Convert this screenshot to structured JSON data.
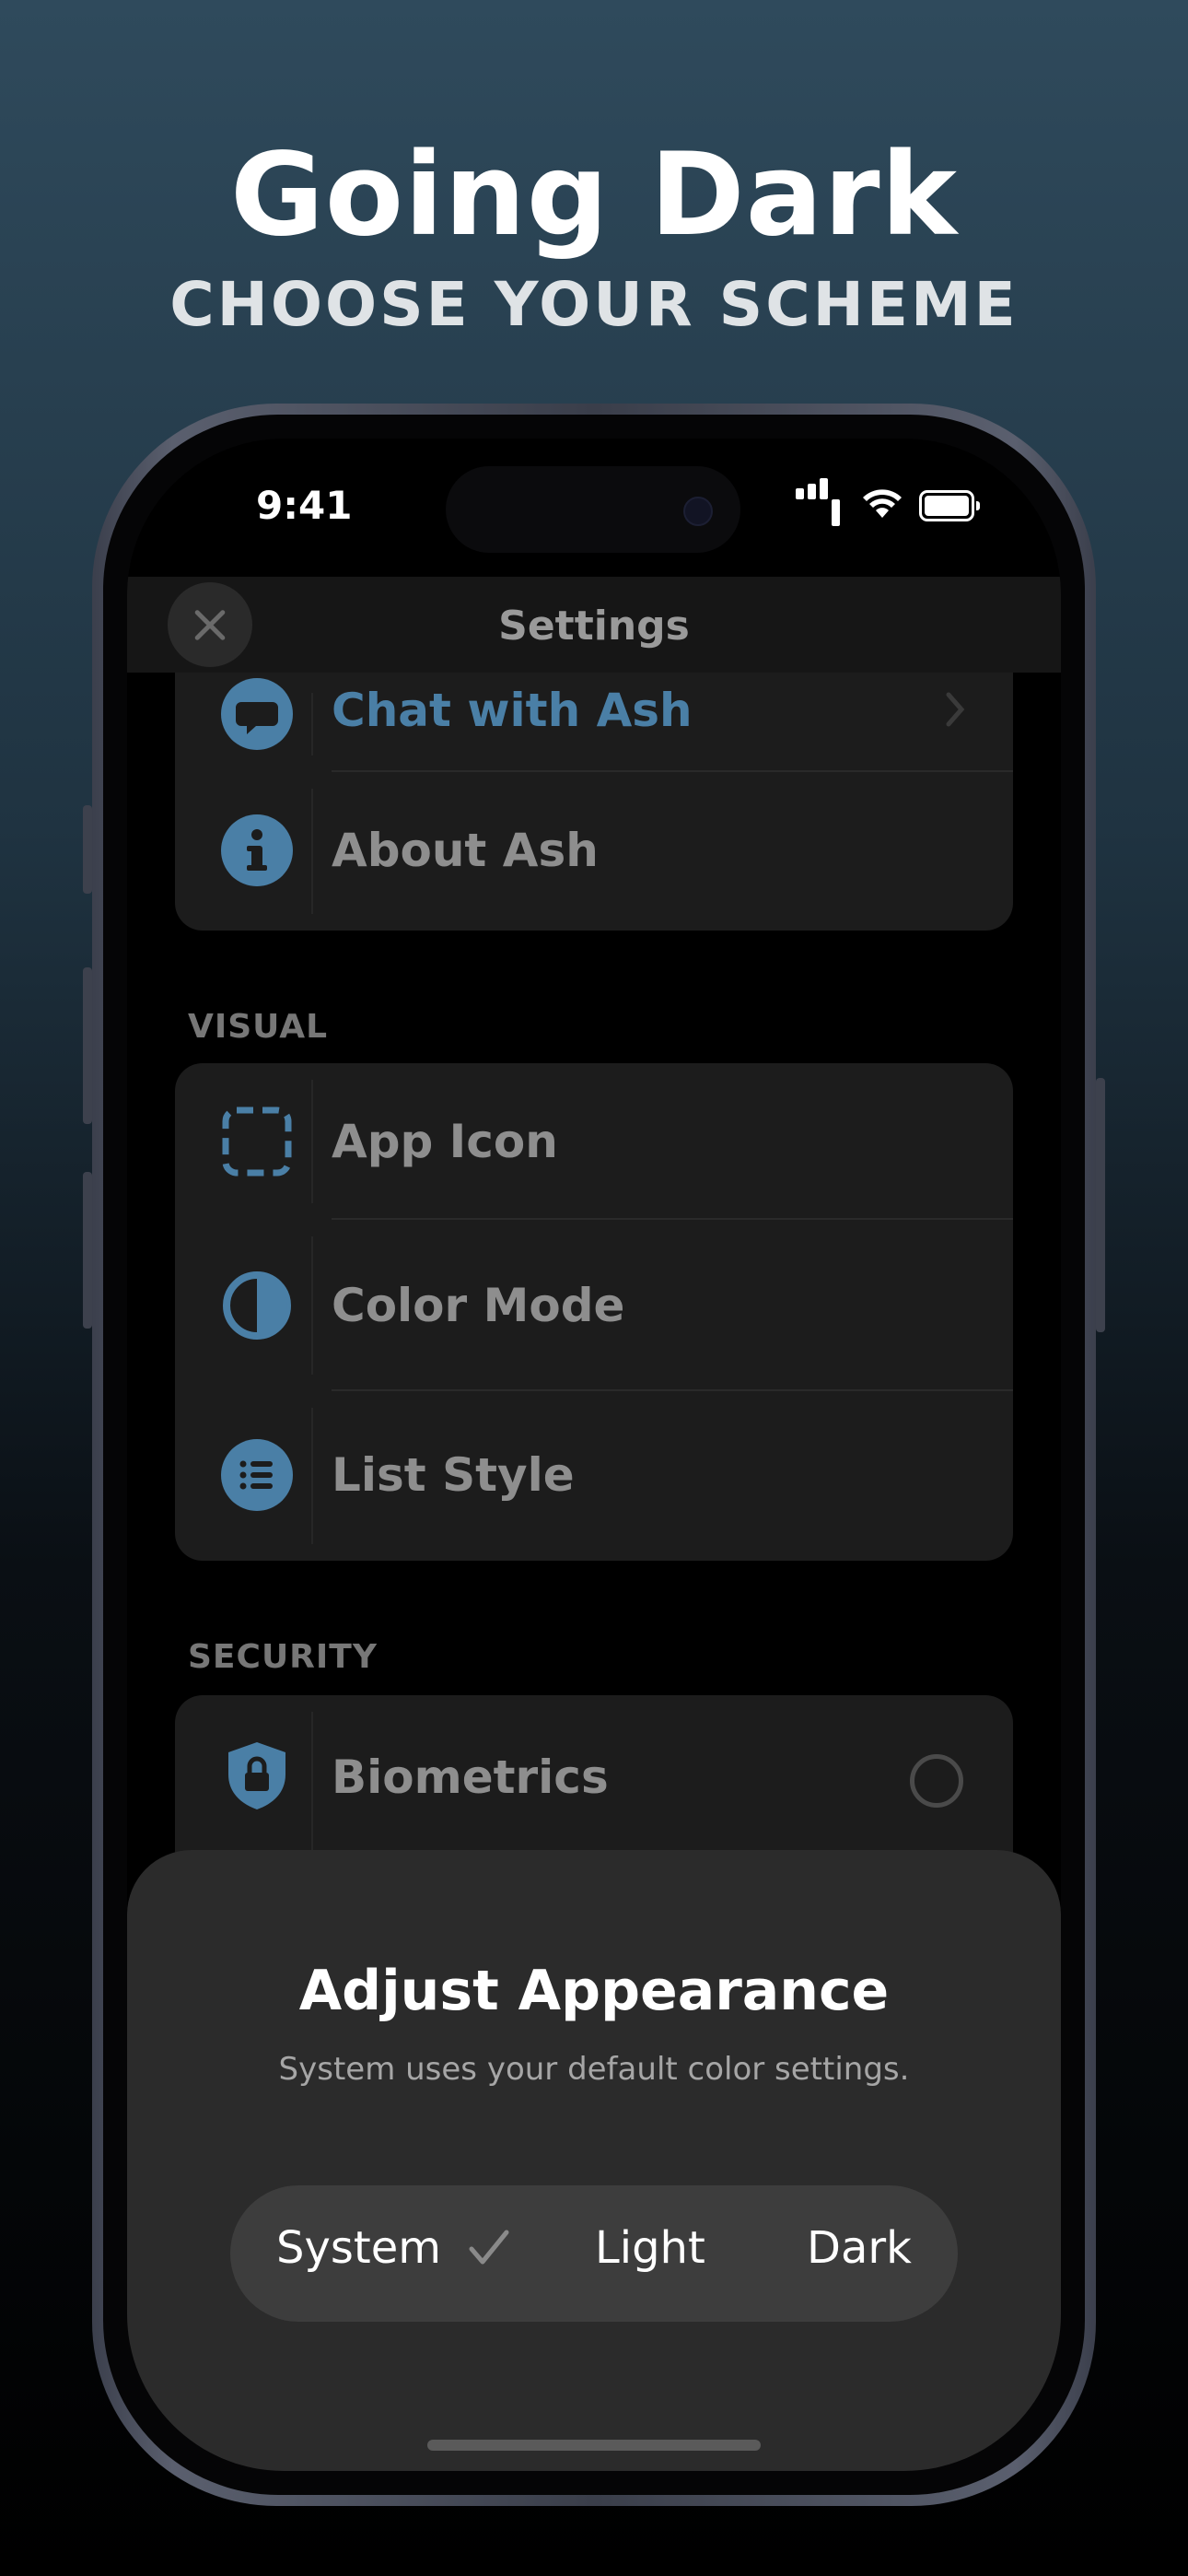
{
  "promo": {
    "title": "Going Dark",
    "subtitle": "CHOOSE YOUR SCHEME"
  },
  "status_bar": {
    "time": "9:41"
  },
  "nav": {
    "title": "Settings"
  },
  "groups": [
    {
      "header": "",
      "items": [
        {
          "label": "Chat with Ash",
          "icon": "chat-bubble-icon",
          "accessory": "chevron-right-icon"
        },
        {
          "label": "About Ash",
          "icon": "info-icon"
        }
      ]
    },
    {
      "header": "VISUAL",
      "items": [
        {
          "label": "App Icon",
          "icon": "dashed-square-icon"
        },
        {
          "label": "Color Mode",
          "icon": "half-circle-icon"
        },
        {
          "label": "List Style",
          "icon": "list-icon"
        }
      ]
    },
    {
      "header": "SECURITY",
      "items": [
        {
          "label": "Biometrics",
          "icon": "lock-shield-icon",
          "accessory": "radio-unchecked"
        }
      ]
    }
  ],
  "sheet": {
    "title": "Adjust Appearance",
    "description": "System uses your default color settings.",
    "options": [
      "System",
      "Light",
      "Dark"
    ],
    "selected": "System"
  },
  "colors": {
    "accent_blue": "#4a7fa6",
    "sheet_bg": "#2b2b2b",
    "segment_bg": "#3d3d3d"
  }
}
